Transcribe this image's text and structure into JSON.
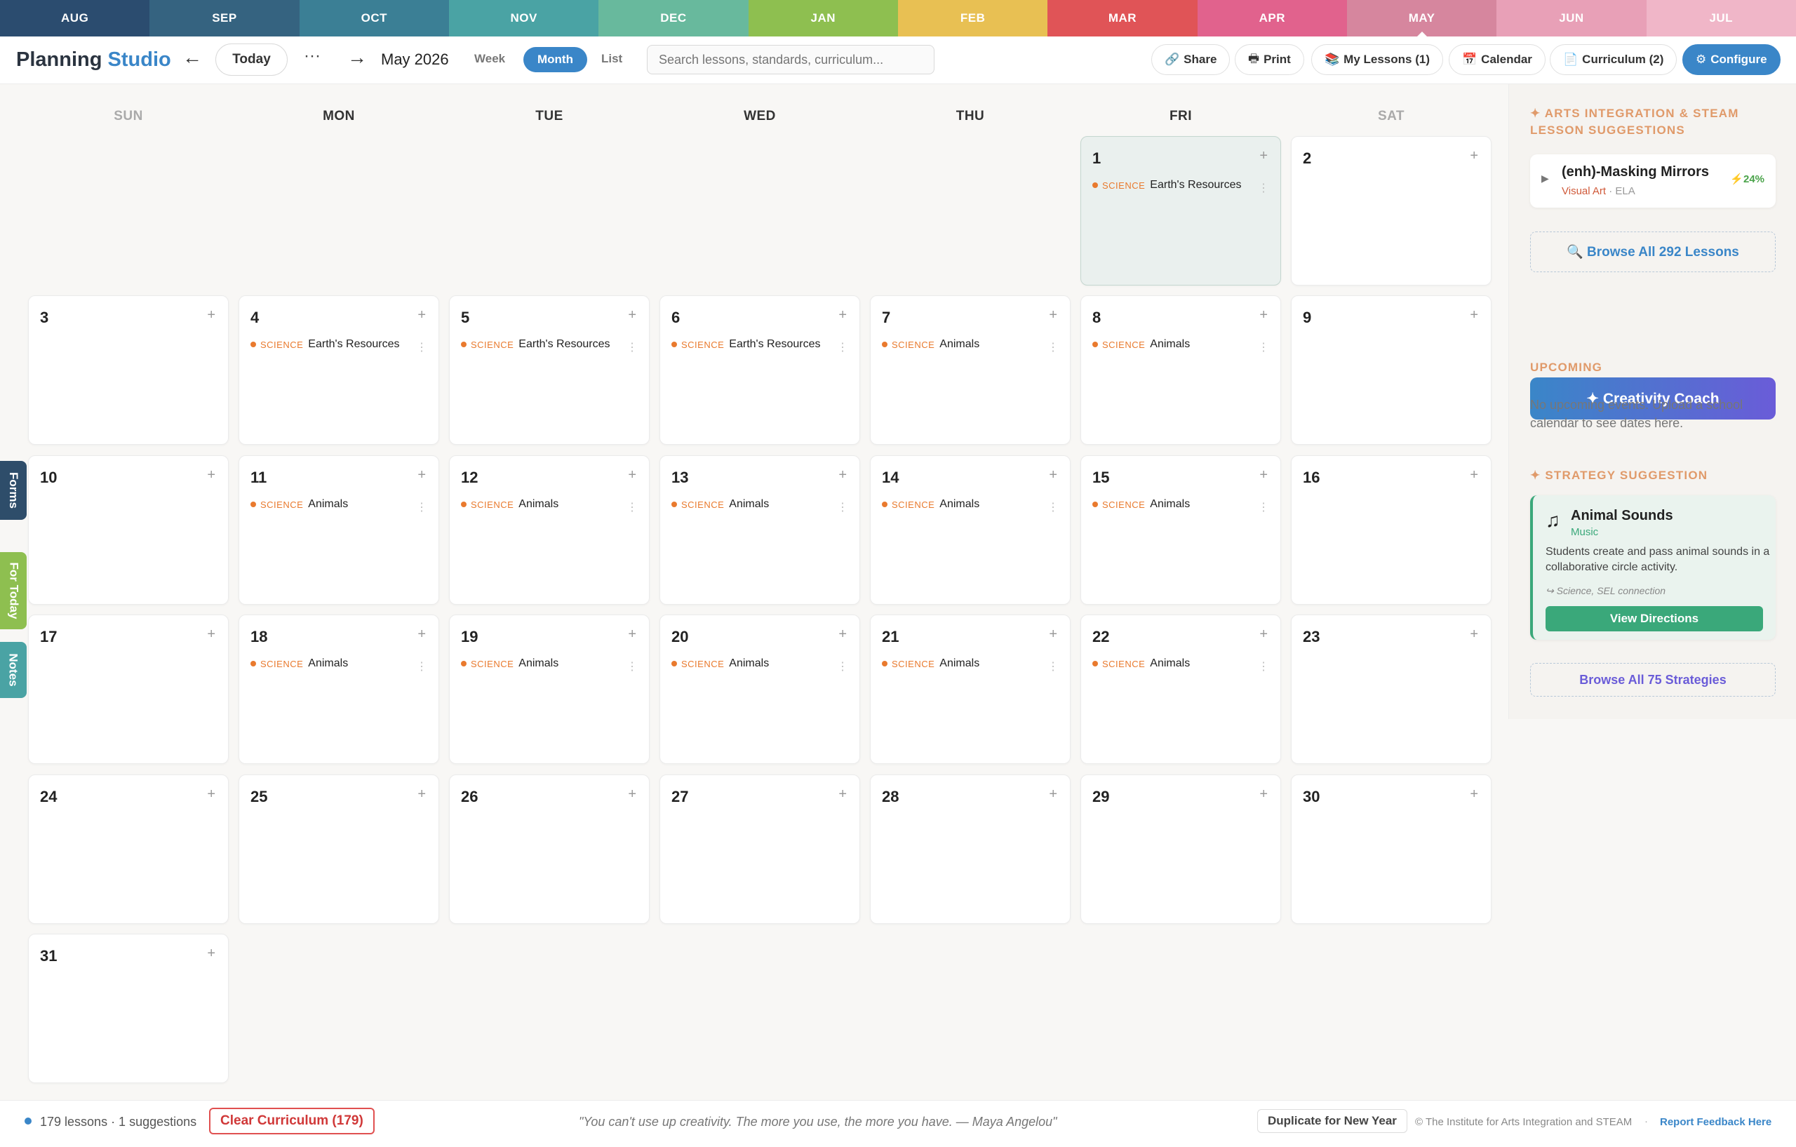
{
  "months": [
    {
      "label": "AUG",
      "color": "#2b4c6f"
    },
    {
      "label": "SEP",
      "color": "#356380"
    },
    {
      "label": "OCT",
      "color": "#3b7f95"
    },
    {
      "label": "NOV",
      "color": "#4aa3a4"
    },
    {
      "label": "DEC",
      "color": "#68b99d"
    },
    {
      "label": "JAN",
      "color": "#8ebf50"
    },
    {
      "label": "FEB",
      "color": "#e8c053"
    },
    {
      "label": "MAR",
      "color": "#e05457"
    },
    {
      "label": "APR",
      "color": "#e1628d"
    },
    {
      "label": "MAY",
      "color": "#d6869e"
    },
    {
      "label": "JUN",
      "color": "#e8a0b7"
    },
    {
      "label": "JUL",
      "color": "#f0b6c8"
    }
  ],
  "active_month": "MAY",
  "toolbar": {
    "brand_1": "Planning",
    "brand_2": "Studio",
    "prev": "←",
    "today": "Today",
    "more": "···",
    "next": "→",
    "month_label": "May 2026",
    "view_week": "Week",
    "view_month": "Month",
    "view_list": "List",
    "search_placeholder": "Search lessons, standards, curriculum...",
    "share": "Share",
    "print": "Print",
    "my_lessons": "My Lessons (1)",
    "calendar": "Calendar",
    "curriculum": "Curriculum (2)",
    "configure": "Configure"
  },
  "weekdays": [
    "SUN",
    "MON",
    "TUE",
    "WED",
    "THU",
    "FRI",
    "SAT"
  ],
  "calendar": {
    "days": [
      {
        "d": "1",
        "col": 5,
        "row": 0,
        "today": true,
        "subject": "SCIENCE",
        "lesson": "Earth's Resources"
      },
      {
        "d": "2",
        "col": 6,
        "row": 0
      },
      {
        "d": "3",
        "col": 0,
        "row": 1
      },
      {
        "d": "4",
        "col": 1,
        "row": 1,
        "subject": "SCIENCE",
        "lesson": "Earth's Resources"
      },
      {
        "d": "5",
        "col": 2,
        "row": 1,
        "subject": "SCIENCE",
        "lesson": "Earth's Resources"
      },
      {
        "d": "6",
        "col": 3,
        "row": 1,
        "subject": "SCIENCE",
        "lesson": "Earth's Resources"
      },
      {
        "d": "7",
        "col": 4,
        "row": 1,
        "subject": "SCIENCE",
        "lesson": "Animals"
      },
      {
        "d": "8",
        "col": 5,
        "row": 1,
        "subject": "SCIENCE",
        "lesson": "Animals"
      },
      {
        "d": "9",
        "col": 6,
        "row": 1
      },
      {
        "d": "10",
        "col": 0,
        "row": 2
      },
      {
        "d": "11",
        "col": 1,
        "row": 2,
        "subject": "SCIENCE",
        "lesson": "Animals"
      },
      {
        "d": "12",
        "col": 2,
        "row": 2,
        "subject": "SCIENCE",
        "lesson": "Animals"
      },
      {
        "d": "13",
        "col": 3,
        "row": 2,
        "subject": "SCIENCE",
        "lesson": "Animals"
      },
      {
        "d": "14",
        "col": 4,
        "row": 2,
        "subject": "SCIENCE",
        "lesson": "Animals"
      },
      {
        "d": "15",
        "col": 5,
        "row": 2,
        "subject": "SCIENCE",
        "lesson": "Animals"
      },
      {
        "d": "16",
        "col": 6,
        "row": 2
      },
      {
        "d": "17",
        "col": 0,
        "row": 3
      },
      {
        "d": "18",
        "col": 1,
        "row": 3,
        "subject": "SCIENCE",
        "lesson": "Animals"
      },
      {
        "d": "19",
        "col": 2,
        "row": 3,
        "subject": "SCIENCE",
        "lesson": "Animals"
      },
      {
        "d": "20",
        "col": 3,
        "row": 3,
        "subject": "SCIENCE",
        "lesson": "Animals"
      },
      {
        "d": "21",
        "col": 4,
        "row": 3,
        "subject": "SCIENCE",
        "lesson": "Animals"
      },
      {
        "d": "22",
        "col": 5,
        "row": 3,
        "subject": "SCIENCE",
        "lesson": "Animals"
      },
      {
        "d": "23",
        "col": 6,
        "row": 3
      },
      {
        "d": "24",
        "col": 0,
        "row": 4
      },
      {
        "d": "25",
        "col": 1,
        "row": 4
      },
      {
        "d": "26",
        "col": 2,
        "row": 4
      },
      {
        "d": "27",
        "col": 3,
        "row": 4
      },
      {
        "d": "28",
        "col": 4,
        "row": 4
      },
      {
        "d": "29",
        "col": 5,
        "row": 4
      },
      {
        "d": "30",
        "col": 6,
        "row": 4
      },
      {
        "d": "31",
        "col": 0,
        "row": 5
      }
    ]
  },
  "side_tabs": [
    {
      "label": "Forms",
      "color": "#2e4d6a"
    },
    {
      "label": "For Today",
      "color": "#8ebf50"
    },
    {
      "label": "Notes",
      "color": "#4aa3a4"
    }
  ],
  "sidebar": {
    "arts_heading": "✦ ARTS INTEGRATION & STEAM LESSON SUGGESTIONS",
    "suggestion": {
      "title": "(enh)-Masking Mirrors",
      "tag": "Visual Art",
      "tag2": "· ELA",
      "score": "⚡24%"
    },
    "browse_lessons": "🔍 Browse All 292 Lessons",
    "coach": "✦ Creativity Coach",
    "upcoming_heading": "UPCOMING",
    "upcoming_text": "No upcoming events. Upload a school calendar to see dates here.",
    "strategy_heading": "✦ STRATEGY SUGGESTION",
    "strategy": {
      "icon": "♫",
      "title": "Animal Sounds",
      "tag": "Music",
      "desc": "Students create and pass animal sounds in a collaborative circle activity.",
      "connection": "↪ Science, SEL connection",
      "button": "View Directions"
    },
    "browse_strategies": "Browse All 75 Strategies"
  },
  "footer": {
    "summary": "179 lessons · 1 suggestions",
    "clear": "Clear Curriculum (179)",
    "quote": "\"You can't use up creativity. The more you use, the more you have. — Maya Angelou\"",
    "duplicate": "Duplicate for New Year",
    "copyright": "© The Institute for Arts Integration and STEAM",
    "sep": "·",
    "feedback": "Report Feedback Here"
  },
  "colors": {
    "accent": "#3a86c8",
    "science": "#e97a2e",
    "strategy": "#3aa87a"
  }
}
